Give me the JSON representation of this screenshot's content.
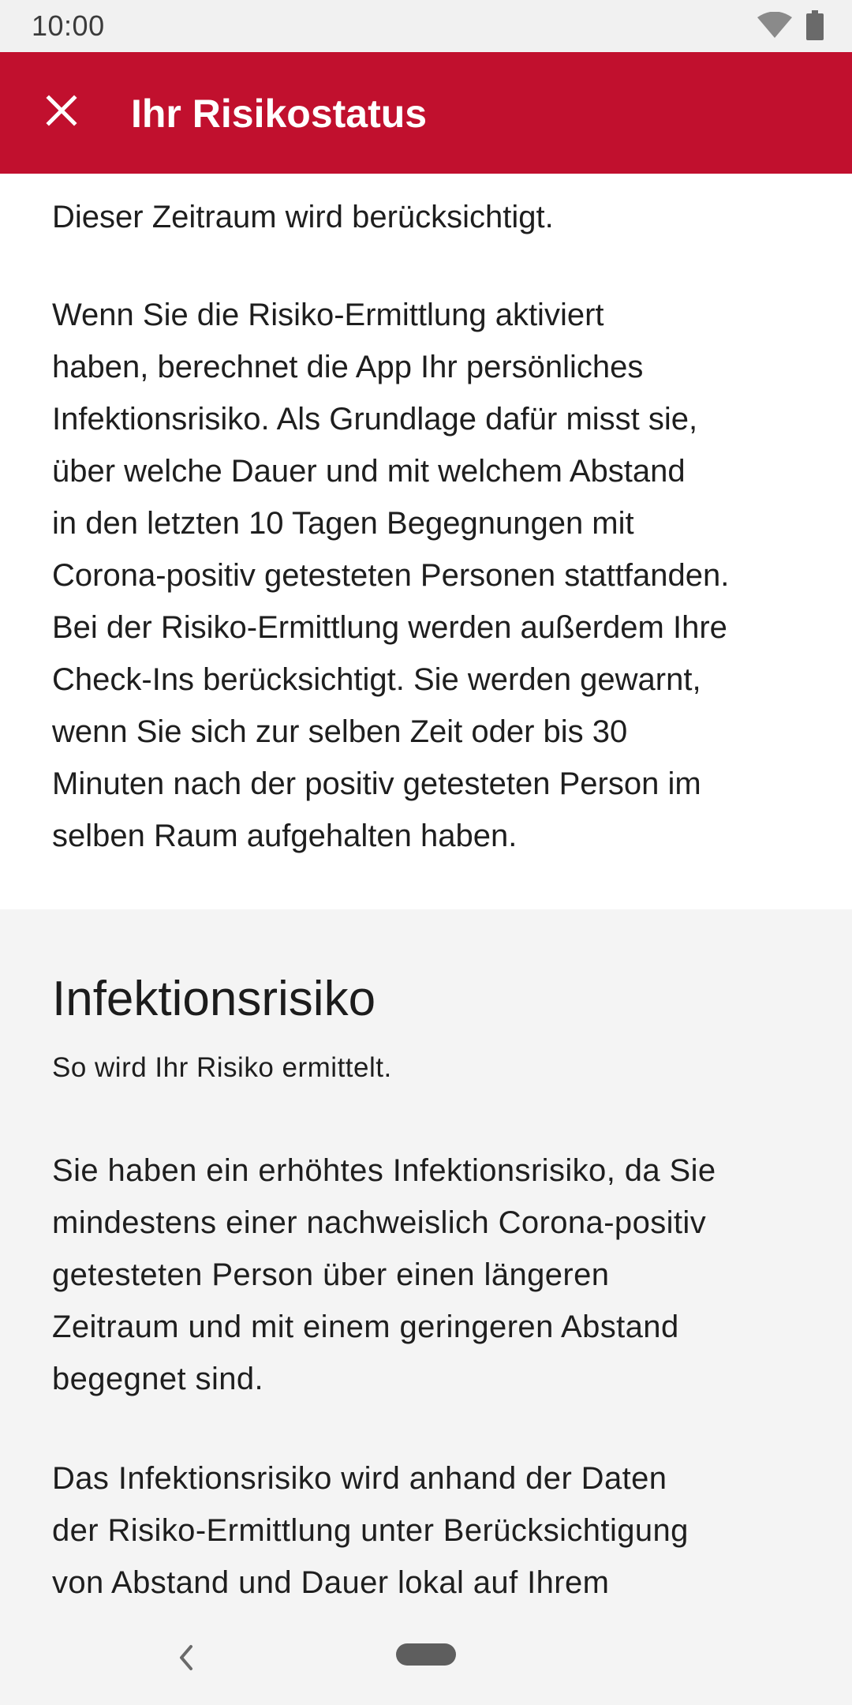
{
  "status_bar": {
    "time": "10:00",
    "icons": [
      "wifi-icon",
      "battery-icon"
    ]
  },
  "app_bar": {
    "title": "Ihr Risikostatus",
    "close_icon": "close-icon",
    "background_color": "#c1102e"
  },
  "intro_section": {
    "lines": [
      "Dieser Zeitraum wird berücksichtigt."
    ],
    "paragraph_lines": [
      "Wenn Sie die Risiko-Ermittlung aktiviert",
      "haben, berechnet die App Ihr persönliches",
      "Infektionsrisiko. Als Grundlage dafür misst sie,",
      "über welche Dauer und mit welchem Abstand",
      "in den letzten 10 Tagen Begegnungen mit",
      "Corona-positiv getesteten Personen stattfanden.",
      "Bei der Risiko-Ermittlung werden außerdem Ihre",
      "Check-Ins berücksichtigt. Sie werden gewarnt,",
      "wenn Sie sich zur selben Zeit oder bis 30",
      "Minuten nach der positiv getesteten Person im",
      "selben Raum aufgehalten haben."
    ]
  },
  "infection_section": {
    "title": "Infektionsrisiko",
    "subtitle": "So wird Ihr Risiko ermittelt.",
    "paragraph1_lines": [
      "Sie haben ein erhöhtes Infektionsrisiko, da Sie",
      "mindestens einer nachweislich Corona-positiv",
      "getesteten Person über einen längeren",
      "Zeitraum und mit einem geringeren Abstand",
      "begegnet sind."
    ],
    "paragraph2_lines": [
      "Das Infektionsrisiko wird anhand der Daten",
      "der Risiko-Ermittlung unter Berücksichtigung",
      "von Abstand und Dauer lokal auf Ihrem"
    ]
  },
  "nav_bar": {
    "back_icon": "back-chevron-icon",
    "home_icon": "home-pill-icon"
  }
}
